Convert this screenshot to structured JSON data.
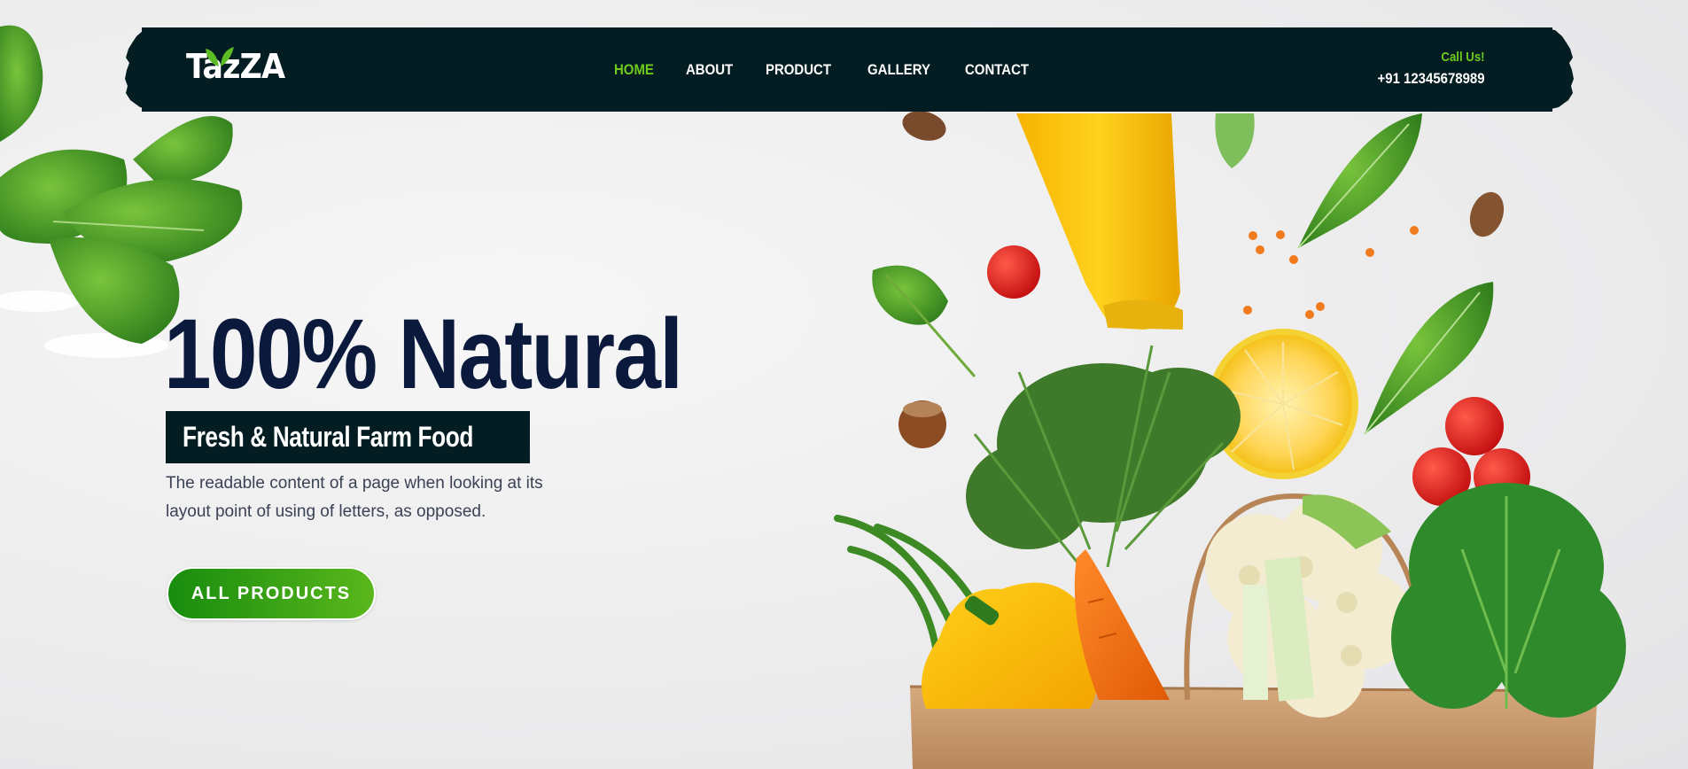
{
  "header": {
    "logo": "TazZA",
    "nav": [
      {
        "label": "HOME",
        "active": true
      },
      {
        "label": "ABOUT",
        "active": false
      },
      {
        "label": "PRODUCT",
        "active": false
      },
      {
        "label": "GALLERY",
        "active": false
      },
      {
        "label": "CONTACT",
        "active": false
      }
    ],
    "call_label": "Call Us!",
    "phone": "+91 12345678989"
  },
  "hero": {
    "title": "100% Natural",
    "subtitle": "Fresh & Natural Farm Food",
    "description": "The readable content of a page when looking at its layout point of using of letters, as opposed.",
    "cta_label": "ALL PRODUCTS"
  },
  "colors": {
    "nav_bg": "#031d22",
    "accent_green": "#6fca1e",
    "title_navy": "#0b1a3c",
    "button_gradient_start": "#188c0e",
    "button_gradient_end": "#5ab71c"
  },
  "icons": {
    "logo_leaf": "leaf-icon"
  }
}
